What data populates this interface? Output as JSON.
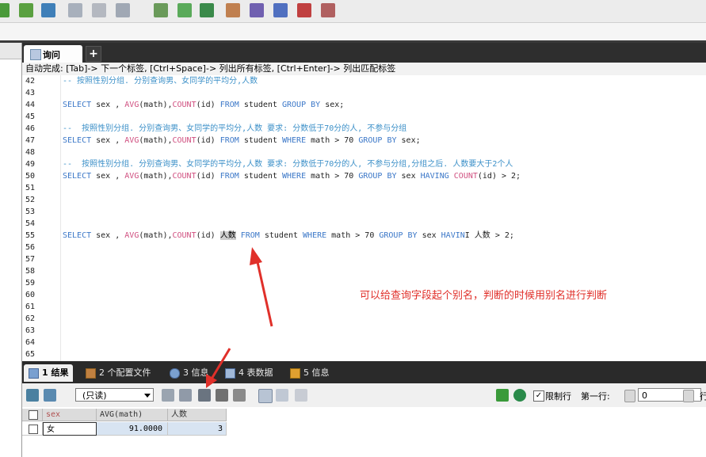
{
  "editor_tab": {
    "label": "询问",
    "add": "+"
  },
  "hint": "自动完成: [Tab]-> 下一个标签, [Ctrl+Space]-> 列出所有标签, [Ctrl+Enter]-> 列出匹配标签",
  "lines": [
    {
      "n": "42",
      "segs": [
        [
          "cm",
          "-- 按照性别分组. 分别查询男、女同学的平均分,人数"
        ]
      ]
    },
    {
      "n": "43",
      "segs": []
    },
    {
      "n": "44",
      "segs": [
        [
          "kw",
          "SELECT"
        ],
        [
          "pl",
          " sex , "
        ],
        [
          "fn",
          "AVG"
        ],
        [
          "pl",
          "(math),"
        ],
        [
          "fn",
          "COUNT"
        ],
        [
          "pl",
          "(id) "
        ],
        [
          "kw",
          "FROM"
        ],
        [
          "pl",
          " student "
        ],
        [
          "kw",
          "GROUP BY"
        ],
        [
          "pl",
          " sex;"
        ]
      ]
    },
    {
      "n": "45",
      "segs": []
    },
    {
      "n": "46",
      "segs": [
        [
          "cm",
          "--  按照性别分组. 分别查询男、女同学的平均分,人数 要求: 分数低于70分的人, 不参与分组"
        ]
      ]
    },
    {
      "n": "47",
      "segs": [
        [
          "kw",
          "SELECT"
        ],
        [
          "pl",
          " sex , "
        ],
        [
          "fn",
          "AVG"
        ],
        [
          "pl",
          "(math),"
        ],
        [
          "fn",
          "COUNT"
        ],
        [
          "pl",
          "(id) "
        ],
        [
          "kw",
          "FROM"
        ],
        [
          "pl",
          " student "
        ],
        [
          "kw",
          "WHERE"
        ],
        [
          "pl",
          " math > 70 "
        ],
        [
          "kw",
          "GROUP BY"
        ],
        [
          "pl",
          " sex;"
        ]
      ]
    },
    {
      "n": "48",
      "segs": []
    },
    {
      "n": "49",
      "segs": [
        [
          "cm",
          "--  按照性别分组. 分别查询男、女同学的平均分,人数 要求: 分数低于70分的人, 不参与分组,分组之后. 人数要大于2个人"
        ]
      ]
    },
    {
      "n": "50",
      "segs": [
        [
          "kw",
          "SELECT"
        ],
        [
          "pl",
          " sex , "
        ],
        [
          "fn",
          "AVG"
        ],
        [
          "pl",
          "(math),"
        ],
        [
          "fn",
          "COUNT"
        ],
        [
          "pl",
          "(id) "
        ],
        [
          "kw",
          "FROM"
        ],
        [
          "pl",
          " student "
        ],
        [
          "kw",
          "WHERE"
        ],
        [
          "pl",
          " math > 70 "
        ],
        [
          "kw",
          "GROUP BY"
        ],
        [
          "pl",
          " sex "
        ],
        [
          "kw",
          "HAVING"
        ],
        [
          "pl",
          " "
        ],
        [
          "fn",
          "COUNT"
        ],
        [
          "pl",
          "(id) > 2;"
        ]
      ]
    },
    {
      "n": "51",
      "segs": []
    },
    {
      "n": "52",
      "segs": []
    },
    {
      "n": "53",
      "segs": []
    },
    {
      "n": "54",
      "segs": []
    },
    {
      "n": "55",
      "segs": [
        [
          "kw",
          "SELECT"
        ],
        [
          "pl",
          " sex , "
        ],
        [
          "fn",
          "AVG"
        ],
        [
          "pl",
          "(math),"
        ],
        [
          "fn",
          "COUNT"
        ],
        [
          "pl",
          "(id) "
        ],
        [
          "hl",
          "人数"
        ],
        [
          "pl",
          " "
        ],
        [
          "kw",
          "FROM"
        ],
        [
          "pl",
          " student "
        ],
        [
          "kw",
          "WHERE"
        ],
        [
          "pl",
          " math > 70 "
        ],
        [
          "kw",
          "GROUP BY"
        ],
        [
          "pl",
          " sex "
        ],
        [
          "kw",
          "HAVIN"
        ],
        [
          "pl",
          "I 人数 > 2;"
        ]
      ]
    },
    {
      "n": "56",
      "segs": []
    },
    {
      "n": "57",
      "segs": []
    },
    {
      "n": "58",
      "segs": []
    },
    {
      "n": "59",
      "segs": []
    },
    {
      "n": "60",
      "segs": []
    },
    {
      "n": "61",
      "segs": []
    },
    {
      "n": "62",
      "segs": []
    },
    {
      "n": "63",
      "segs": []
    },
    {
      "n": "64",
      "segs": []
    },
    {
      "n": "65",
      "segs": []
    }
  ],
  "annotation": "可以给查询字段起个别名，判断的时候用别名进行判断",
  "result_tabs": {
    "t1": "1 结果",
    "t2": "2 个配置文件",
    "t3": "3 信息",
    "t4": "4 表数据",
    "t5": "5 信息"
  },
  "result_toolbar": {
    "mode": "(只读)",
    "limit_check": "✓",
    "limit_label": "限制行",
    "first_row_label": "第一行:",
    "first_row_value": "0",
    "row_count_label": "行"
  },
  "grid": {
    "headers": [
      "sex",
      "AVG(math)",
      "人数"
    ],
    "row": [
      "女",
      "91.0000",
      "3"
    ]
  },
  "colors": {
    "keyword": "#3c78c8",
    "function": "#d05080",
    "annotation": "#e0302a"
  }
}
